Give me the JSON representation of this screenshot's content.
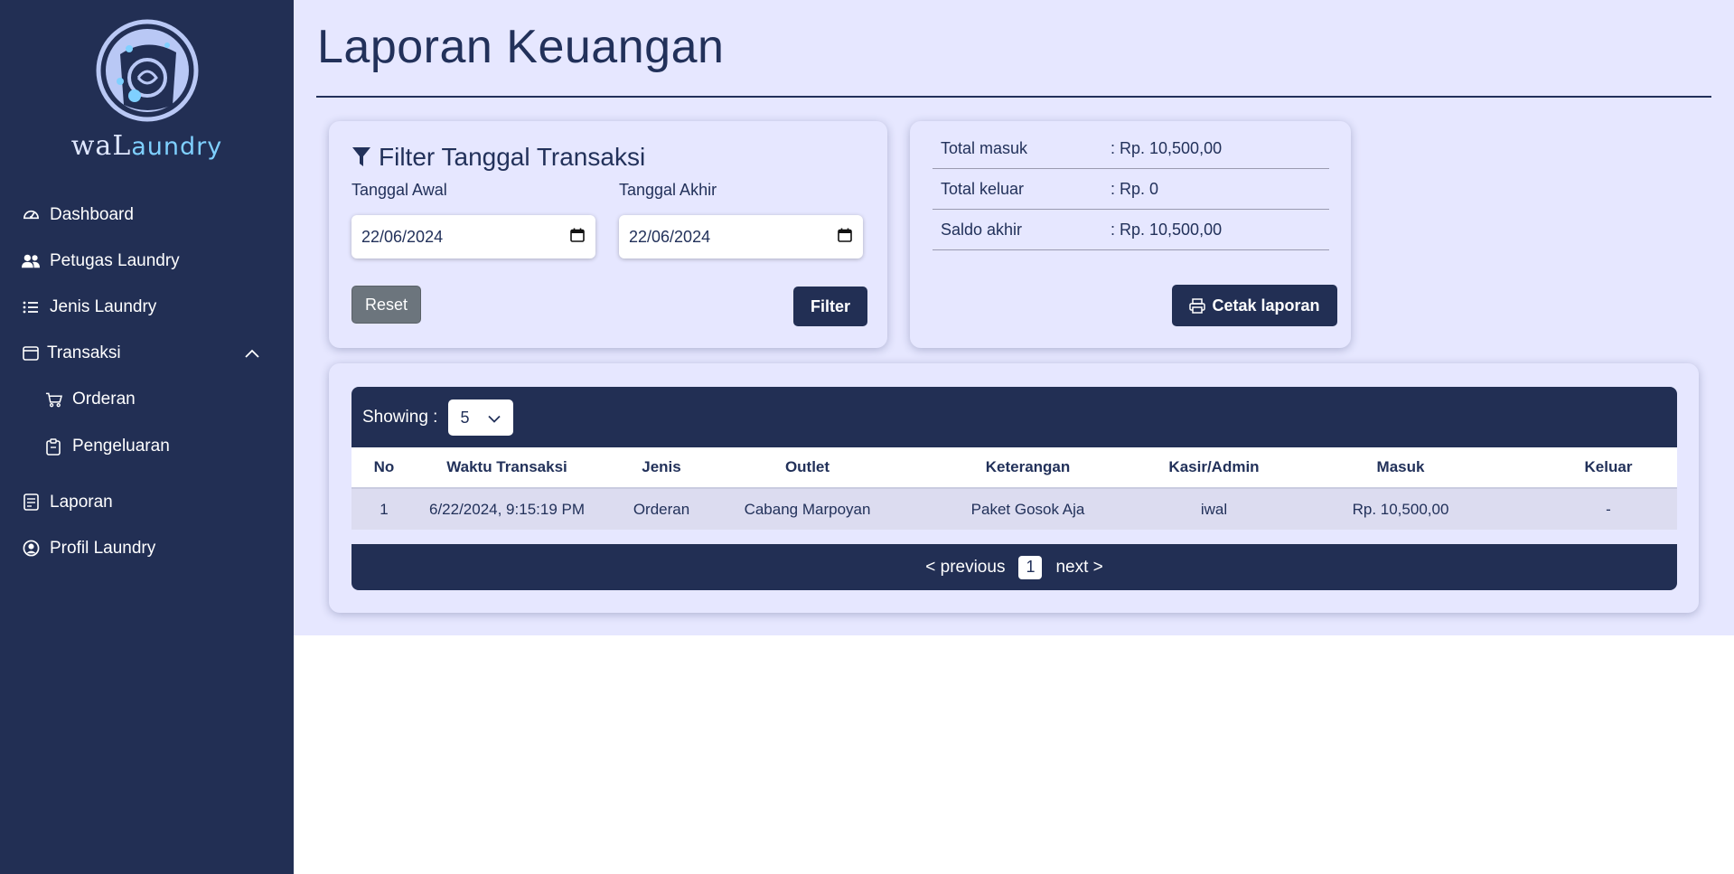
{
  "brand": {
    "prefix": "waL",
    "accent": "aundry"
  },
  "sidebar": {
    "items": [
      {
        "label": "Dashboard",
        "icon": "gauge-icon"
      },
      {
        "label": "Petugas Laundry",
        "icon": "users-icon"
      },
      {
        "label": "Jenis Laundry",
        "icon": "list-icon"
      },
      {
        "label": "Transaksi",
        "icon": "window-icon"
      },
      {
        "label": "Orderan",
        "icon": "cart-icon"
      },
      {
        "label": "Pengeluaran",
        "icon": "clipboard-icon"
      },
      {
        "label": "Laporan",
        "icon": "report-icon"
      },
      {
        "label": "Profil Laundry",
        "icon": "user-circle-icon"
      }
    ]
  },
  "page": {
    "title": "Laporan Keuangan"
  },
  "filter": {
    "title": "Filter Tanggal Transaksi",
    "start_label": "Tanggal Awal",
    "start_value": "22/06/2024",
    "end_label": "Tanggal Akhir",
    "end_value": "22/06/2024",
    "reset_label": "Reset",
    "filter_label": "Filter"
  },
  "summary": {
    "rows": [
      {
        "key": "Total masuk",
        "value": ": Rp. 10,500,00"
      },
      {
        "key": "Total keluar",
        "value": ": Rp. 0"
      },
      {
        "key": "Saldo akhir",
        "value": ": Rp. 10,500,00"
      }
    ],
    "print_label": "Cetak laporan"
  },
  "table": {
    "showing_label": "Showing :",
    "page_size": "5",
    "columns": [
      "No",
      "Waktu Transaksi",
      "Jenis",
      "Outlet",
      "Keterangan",
      "Kasir/Admin",
      "Masuk",
      "Keluar"
    ],
    "rows": [
      [
        "1",
        "6/22/2024, 9:15:19 PM",
        "Orderan",
        "Cabang Marpoyan",
        "Paket Gosok Aja",
        "iwal",
        "Rp. 10,500,00",
        "-"
      ]
    ],
    "pagination": {
      "prev": "< previous",
      "current": "1",
      "next": "next >"
    }
  },
  "colors": {
    "sidebar": "#222f54",
    "main_bg": "#e6e7ff",
    "accent": "#7fd0ff",
    "reset": "#6c757d"
  }
}
